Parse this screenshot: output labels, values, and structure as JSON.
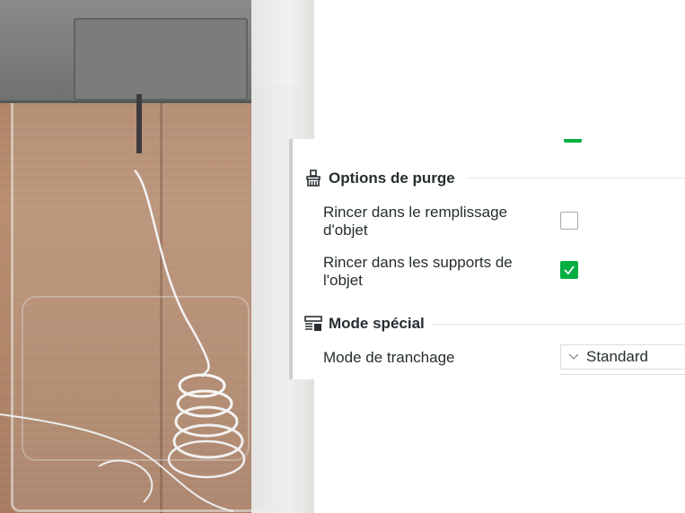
{
  "panel": {
    "purge_section": {
      "title": "Options de purge",
      "icon": "purge-icon",
      "options": [
        {
          "label": "Rincer dans le remplissage d'objet",
          "checked": false
        },
        {
          "label": "Rincer dans les supports de l'objet",
          "checked": true
        }
      ]
    },
    "special_section": {
      "title": "Mode spécial",
      "icon": "special-mode-icon",
      "slicing_mode": {
        "label": "Mode de tranchage",
        "value": "Standard"
      }
    }
  },
  "colors": {
    "accent": "#00ae42",
    "text": "#262e30",
    "divider": "#e6e6e6",
    "panel_border": "#cfcfcf"
  }
}
